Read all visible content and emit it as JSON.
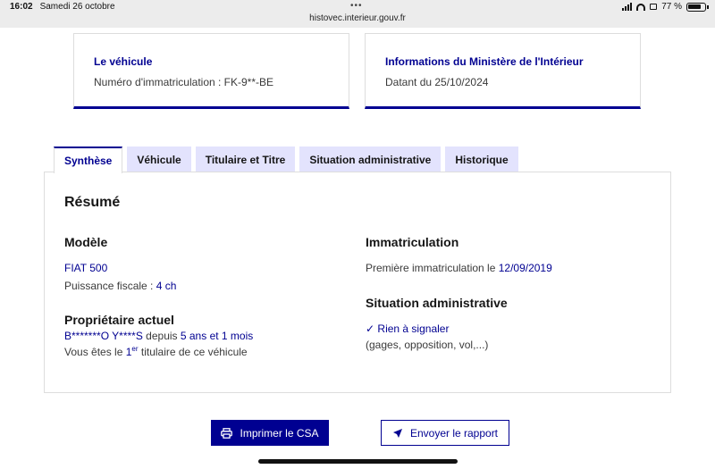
{
  "status_bar": {
    "time": "16:02",
    "date": "Samedi 26 octobre",
    "url": "histovec.interieur.gouv.fr",
    "battery": "77 %"
  },
  "vehicle_card": {
    "title": "Le véhicule",
    "registration_label": "Numéro d'immatriculation : ",
    "registration_value": "FK-9**-BE"
  },
  "ministry_card": {
    "title": "Informations du Ministère de l'Intérieur",
    "date_text": "Datant du 25/10/2024"
  },
  "tabs": [
    {
      "label": "Synthèse",
      "active": true
    },
    {
      "label": "Véhicule",
      "active": false
    },
    {
      "label": "Titulaire et Titre",
      "active": false
    },
    {
      "label": "Situation administrative",
      "active": false
    },
    {
      "label": "Historique",
      "active": false
    }
  ],
  "summary": {
    "heading": "Résumé",
    "model": {
      "heading": "Modèle",
      "name": "FIAT 500",
      "fiscal_power_label": "Puissance fiscale : ",
      "fiscal_power_value": "4 ch"
    },
    "owner": {
      "heading": "Propriétaire actuel",
      "name": "B*******O Y****S",
      "since_label": " depuis ",
      "since_value": "5 ans et 1 mois",
      "holder_prefix": "Vous êtes le ",
      "holder_rank": "1",
      "holder_sup": "er",
      "holder_suffix": " titulaire de ce véhicule"
    },
    "registration": {
      "heading": "Immatriculation",
      "first_label": "Première immatriculation le ",
      "first_date": "12/09/2019"
    },
    "admin_status": {
      "heading": "Situation administrative",
      "status": "Rien à signaler",
      "detail": "(gages, opposition, vol,...)"
    }
  },
  "buttons": {
    "print": "Imprimer le CSA",
    "send": "Envoyer le rapport"
  },
  "colors": {
    "primary": "#000091",
    "tab_bg": "#e3e3fd"
  }
}
